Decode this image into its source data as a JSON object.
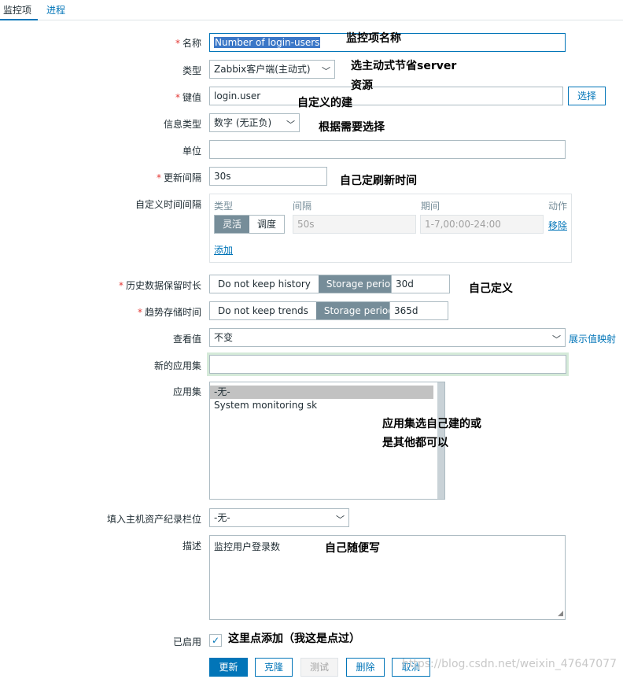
{
  "tabs": {
    "items": [
      "监控项",
      "进程"
    ]
  },
  "form": {
    "name": {
      "label": "名称",
      "value": "Number of login-users"
    },
    "type": {
      "label": "类型",
      "value": "Zabbix客户端(主动式)"
    },
    "key": {
      "label": "键值",
      "value": "login.user",
      "select_button": "选择"
    },
    "info_type": {
      "label": "信息类型",
      "value": "数字 (无正负)"
    },
    "units": {
      "label": "单位",
      "value": ""
    },
    "interval": {
      "label": "更新间隔",
      "value": "30s"
    },
    "custom_intervals": {
      "label": "自定义时间间隔",
      "headers": {
        "type": "类型",
        "interval": "间隔",
        "period": "期间",
        "action": "动作"
      },
      "toggle": {
        "flexible": "灵活",
        "scheduling": "调度"
      },
      "interval_placeholder": "50s",
      "period_placeholder": "1-7,00:00-24:00",
      "remove": "移除",
      "add": "添加"
    },
    "history": {
      "label": "历史数据保留时长",
      "no_keep": "Do not keep history",
      "storage": "Storage period",
      "value": "30d"
    },
    "trends": {
      "label": "趋势存储时间",
      "no_keep": "Do not keep trends",
      "storage": "Storage period",
      "value": "365d"
    },
    "show_value": {
      "label": "查看值",
      "value": "不变",
      "link": "展示值映射"
    },
    "new_app": {
      "label": "新的应用集",
      "value": ""
    },
    "applications": {
      "label": "应用集",
      "options": [
        "-无-",
        "System monitoring sk"
      ]
    },
    "inventory": {
      "label": "填入主机资产纪录栏位",
      "value": "-无-"
    },
    "description": {
      "label": "描述",
      "value": "监控用户登录数"
    },
    "enabled": {
      "label": "已启用",
      "checked": true,
      "check_glyph": "✓"
    },
    "buttons": {
      "update": "更新",
      "clone": "克隆",
      "test": "测试",
      "delete": "删除",
      "cancel": "取消"
    },
    "required_mark": "*"
  },
  "annotations": {
    "name": "监控项名称",
    "type_1": "选主动式节省server",
    "type_2": "资源",
    "key": "自定义的建",
    "info_type": "根据需要选择",
    "interval": "自己定刷新时间",
    "history": "自己定义",
    "apps_1": "应用集选自己建的或",
    "apps_2": "是其他都可以",
    "description": "自己随便写",
    "enabled": "这里点添加（我这是点过）"
  },
  "watermark": "https://blog.csdn.net/weixin_47647077",
  "icons": {
    "chevron": "chevron-down-icon",
    "check": "check-icon"
  },
  "colors": {
    "accent": "#0275b8",
    "required": "#e33734",
    "segment_on": "#768d99"
  }
}
